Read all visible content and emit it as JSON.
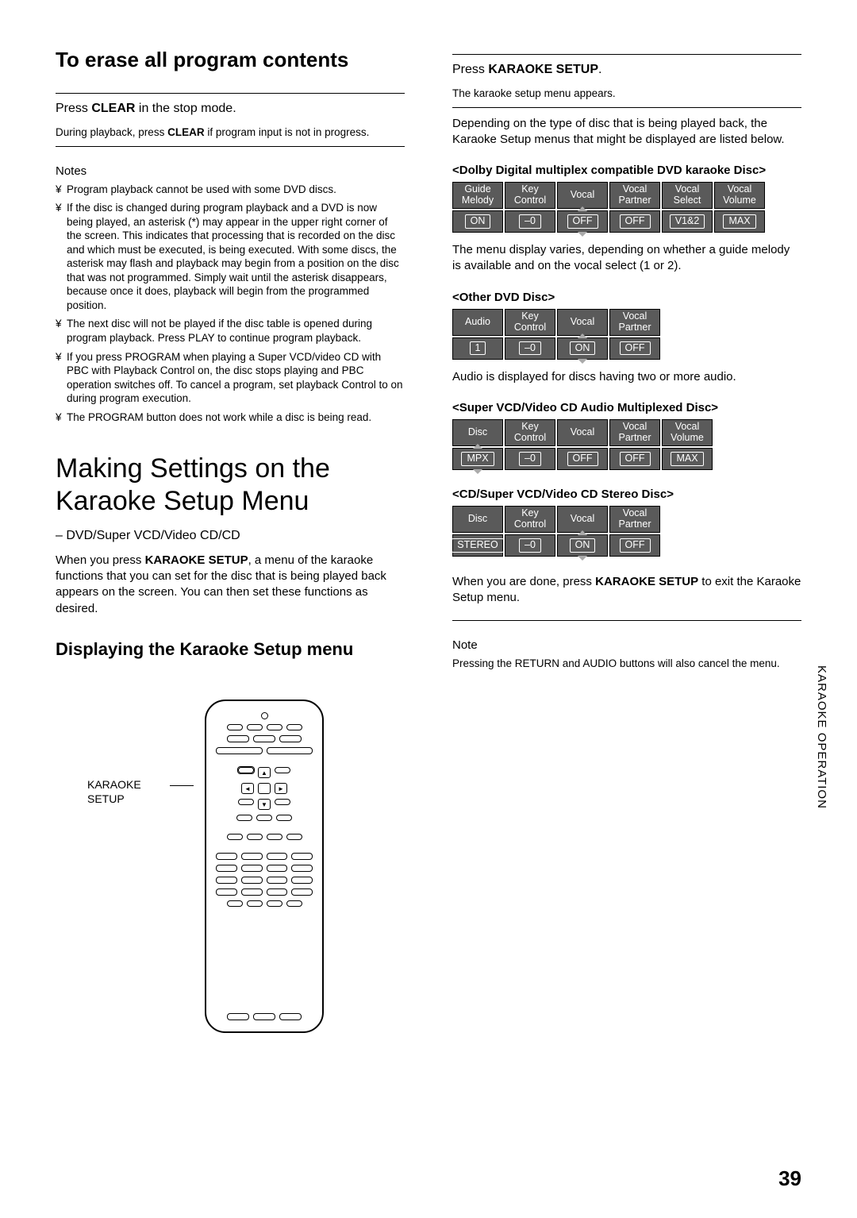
{
  "left": {
    "erase_title": "To erase all program contents",
    "erase_p1_pre": "Press ",
    "erase_p1_bold": "CLEAR",
    "erase_p1_post": " in the stop mode.",
    "erase_p2_pre": "During playback, press ",
    "erase_p2_bold": "CLEAR",
    "erase_p2_post": " if program input is not in progress.",
    "notes_heading": "Notes",
    "notes": [
      "Program playback cannot be used with some DVD discs.",
      "If the disc is changed during program playback and a DVD is now being played, an asterisk (*) may appear in the upper right corner of the screen. This indicates that processing that is recorded on the disc and which must be executed, is being executed. With some discs, the asterisk may flash and playback may begin from a position on the disc that was not programmed. Simply wait until the asterisk disappears, because once it does, playback will begin from the programmed position.",
      "The next disc will not be played if the disc table is opened during program playback. Press PLAY to continue program playback.",
      "If you press PROGRAM when playing a Super VCD/video CD with PBC with Playback Control on, the disc stops playing and PBC operation switches off. To cancel a program, set playback Control to on during program execution.",
      "The PROGRAM button does not work while a disc is being read."
    ],
    "big_title_l1": "Making Settings on the",
    "big_title_l2": "Karaoke Setup Menu",
    "media_line": "– DVD/Super VCD/Video CD/CD",
    "intro_pre": "When you press ",
    "intro_bold": "KARAOKE SETUP",
    "intro_post": ", a menu of the karaoke functions that you can set for the disc that is being played back appears on the screen. You can then set these functions as desired.",
    "subsection": "Displaying the Karaoke Setup menu",
    "remote_label": "KARAOKE SETUP"
  },
  "right": {
    "step_pre": "Press ",
    "step_bold": "KARAOKE SETUP",
    "step_post": ".",
    "step_sub": "The karaoke setup menu appears.",
    "depending": "Depending on the type of disc that is being played back, the Karaoke Setup menus that might be displayed are listed below.",
    "t1_label": "<Dolby Digital multiplex compatible DVD karaoke Disc>",
    "t1": {
      "headers": [
        "Guide Melody",
        "Key Control",
        "Vocal",
        "Vocal Partner",
        "Vocal Select",
        "Vocal Volume"
      ],
      "values": [
        "ON",
        "–0",
        "OFF",
        "OFF",
        "V1&2",
        "MAX"
      ],
      "spin": [
        false,
        false,
        true,
        false,
        false,
        false
      ]
    },
    "t1_note": "The menu display varies, depending on whether a guide melody is available and on the vocal select (1 or 2).",
    "t2_label": "<Other DVD Disc>",
    "t2": {
      "headers": [
        "Audio",
        "Key Control",
        "Vocal",
        "Vocal Partner"
      ],
      "values": [
        "1",
        "–0",
        "ON",
        "OFF"
      ],
      "spin": [
        false,
        false,
        true,
        false
      ]
    },
    "t2_note": "Audio  is displayed for discs having two or more audio.",
    "t3_label": "<Super VCD/Video CD Audio Multiplexed Disc>",
    "t3": {
      "headers": [
        "Disc",
        "Key Control",
        "Vocal",
        "Vocal Partner",
        "Vocal Volume"
      ],
      "values": [
        "MPX",
        "–0",
        "OFF",
        "OFF",
        "MAX"
      ],
      "spin": [
        true,
        false,
        false,
        false,
        false
      ]
    },
    "t4_label": "<CD/Super VCD/Video CD Stereo Disc>",
    "t4": {
      "headers": [
        "Disc",
        "Key Control",
        "Vocal",
        "Vocal Partner"
      ],
      "values": [
        "STEREO",
        "–0",
        "ON",
        "OFF"
      ],
      "spin": [
        false,
        false,
        true,
        false
      ]
    },
    "done_pre": "When you are done, press ",
    "done_bold": "KARAOKE SETUP",
    "done_post": " to exit the Karaoke Setup menu.",
    "note_heading": "Note",
    "note_body": "Pressing the RETURN and AUDIO buttons will also cancel the menu."
  },
  "sidetab": "KARAOKE OPERATION",
  "pagenum": "39"
}
